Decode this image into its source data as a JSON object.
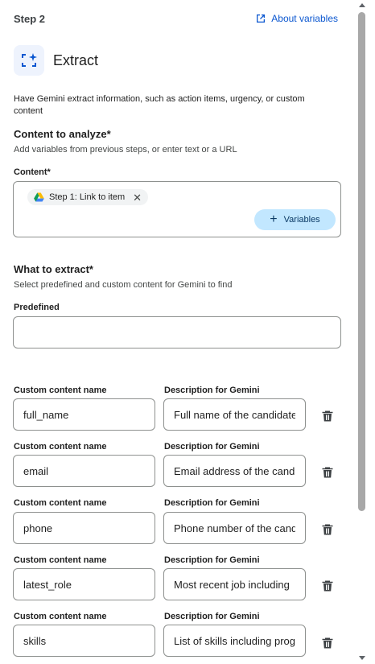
{
  "header": {
    "step": "Step 2",
    "about_link": "About variables",
    "title": "Extract",
    "description": "Have Gemini extract information, such as action items, urgency, or custom content"
  },
  "content_section": {
    "title": "Content to analyze*",
    "subtitle": "Add variables from previous steps, or enter text or a URL",
    "field_label": "Content*",
    "chip_label": "Step 1: Link to item",
    "variables_button": "Variables"
  },
  "extract_section": {
    "title": "What to extract*",
    "subtitle": "Select predefined and custom content for Gemini to find",
    "predefined_label": "Predefined",
    "predefined_value": ""
  },
  "custom_fields": {
    "name_label": "Custom content name",
    "desc_label": "Description for Gemini",
    "rows": [
      {
        "name": "full_name",
        "description": "Full name of the candidate"
      },
      {
        "name": "email",
        "description": "Email address of the candidate"
      },
      {
        "name": "phone",
        "description": "Phone number of the candidate"
      },
      {
        "name": "latest_role",
        "description": "Most recent job including"
      },
      {
        "name": "skills",
        "description": "List of skills including programming"
      }
    ]
  },
  "icons": {
    "about": "open-in-new-icon",
    "extract": "extract-icon",
    "drive": "google-drive-icon",
    "close": "close-icon",
    "add": "plus-icon",
    "delete": "trash-icon"
  },
  "colors": {
    "accent": "#0b57d0",
    "variables_button_bg": "#c2e7ff",
    "border": "#8e918f"
  }
}
